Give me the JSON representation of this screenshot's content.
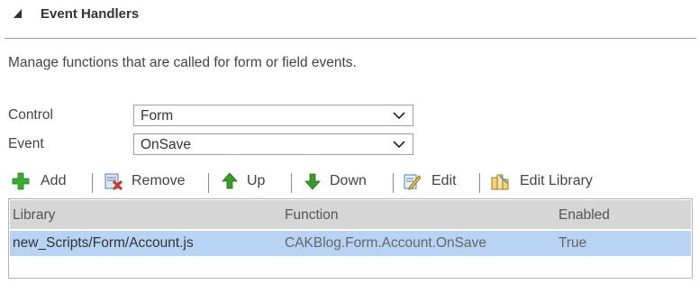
{
  "section": {
    "title": "Event Handlers"
  },
  "description": "Manage functions that are called for form or field events.",
  "fields": {
    "control": {
      "label": "Control",
      "value": "Form"
    },
    "event": {
      "label": "Event",
      "value": "OnSave"
    }
  },
  "toolbar": {
    "add": "Add",
    "remove": "Remove",
    "up": "Up",
    "down": "Down",
    "edit": "Edit",
    "edit_library": "Edit Library"
  },
  "grid": {
    "headers": {
      "library": "Library",
      "function": "Function",
      "enabled": "Enabled"
    },
    "rows": [
      {
        "library": "new_Scripts/Form/Account.js",
        "function": "CAKBlog.Form.Account.OnSave",
        "enabled": "True"
      }
    ]
  },
  "colors": {
    "selected_row": "#b8d3f4",
    "header_bg": "#d6d6d6",
    "text": "#444444",
    "function_text": "#666666",
    "add_icon": "#3cab36",
    "remove_icon": "#c0392b",
    "arrow_icon": "#3a9a2a"
  },
  "icons": [
    "collapse-triangle-icon",
    "chevron-down-icon",
    "plus-icon",
    "remove-icon",
    "arrow-up-icon",
    "arrow-down-icon",
    "edit-icon",
    "library-icon"
  ]
}
